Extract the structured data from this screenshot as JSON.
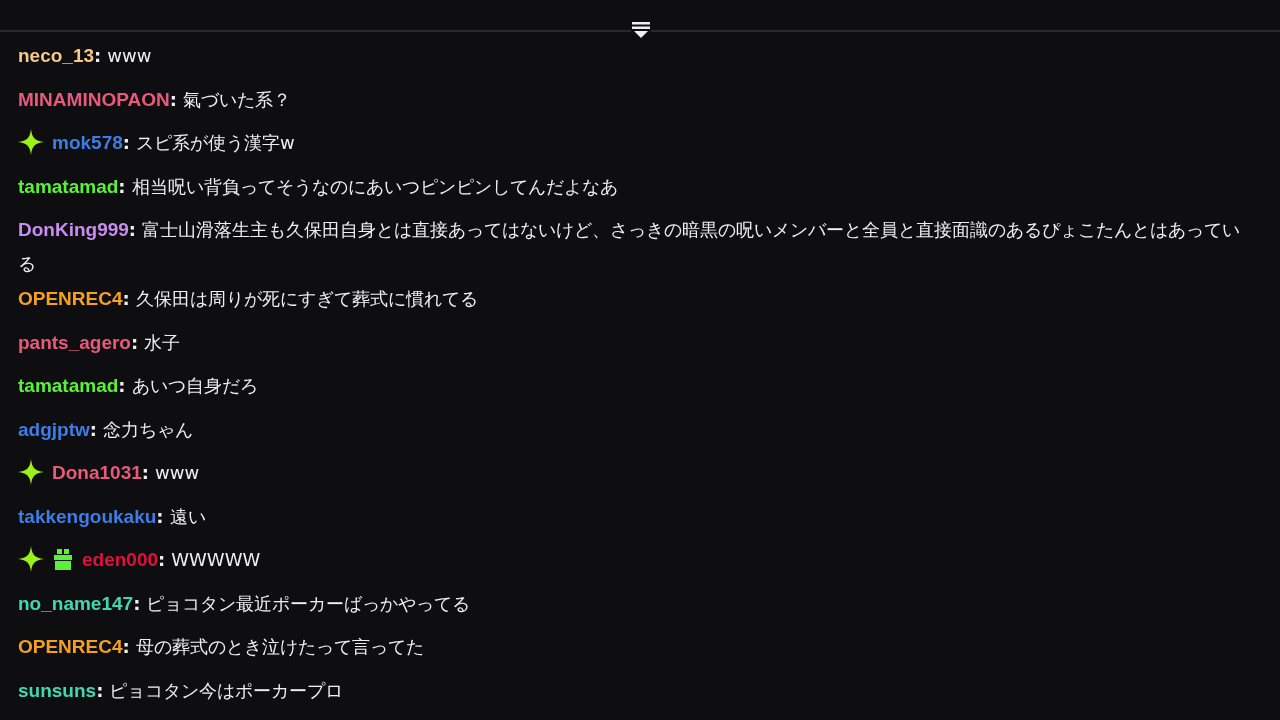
{
  "messages": [
    {
      "user": "neco_13",
      "color": "#f5c98a",
      "separator": ":",
      "text": "www"
    },
    {
      "user": "MINAMINOPAON",
      "color": "#e8587f",
      "separator": ":",
      "text": "氣づいた系？"
    },
    {
      "user": "mok578",
      "color": "#3c7ee6",
      "separator": ":",
      "text": "スピ系が使う漢字w",
      "badges": [
        {
          "kind": "sparkle"
        }
      ]
    },
    {
      "user": "tamatamad",
      "color": "#5cf03c",
      "separator": ":",
      "text": "相当呪い背負ってそうなのにあいつピンピンしてんだよなあ"
    },
    {
      "user": "DonKing999",
      "color": "#c98cf0",
      "separator": ":",
      "text": "富士山滑落生主も久保田自身とは直接あってはないけど、さっきの暗黒の呪いメンバーと全員と直接面識のあるぴょこたんとはあっている"
    },
    {
      "user": "OPENREC4",
      "color": "#f5a020",
      "separator": ":",
      "text": "久保田は周りが死にすぎて葬式に慣れてる"
    },
    {
      "user": "pants_agero",
      "color": "#e8587f",
      "separator": ":",
      "text": "水子"
    },
    {
      "user": "tamatamad",
      "color": "#5cf03c",
      "separator": ":",
      "text": "あいつ自身だろ"
    },
    {
      "user": "adgjptw",
      "color": "#3c7ee6",
      "separator": ":",
      "text": "念力ちゃん"
    },
    {
      "user": "Dona1031",
      "color": "#e8587f",
      "separator": ":",
      "text": "www",
      "badges": [
        {
          "kind": "sparkle"
        }
      ]
    },
    {
      "user": "takkengoukaku",
      "color": "#3c7ee6",
      "separator": ":",
      "text": "遠い"
    },
    {
      "user": "eden000",
      "color": "#e0103c",
      "separator": ":",
      "text": "WWWWW",
      "badges": [
        {
          "kind": "sparkle"
        },
        {
          "kind": "gift"
        }
      ]
    },
    {
      "user": "no_name147",
      "color": "#40d8b0",
      "separator": ":",
      "text": "ピョコタン最近ポーカーばっかやってる"
    },
    {
      "user": "OPENREC4",
      "color": "#f5a020",
      "separator": ":",
      "text": "母の葬式のとき泣けたって言ってた"
    },
    {
      "user": "sunsuns",
      "color": "#40d8b0",
      "separator": ":",
      "text": "ピョコタン今はポーカープロ"
    }
  ]
}
